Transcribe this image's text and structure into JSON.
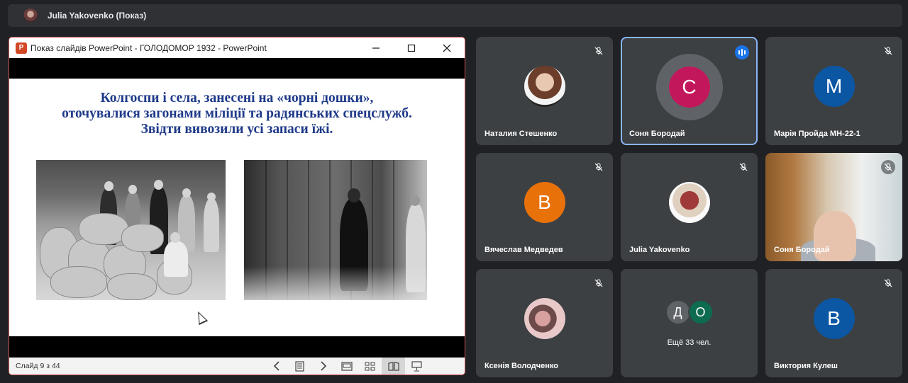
{
  "topbar": {
    "presenter_title": "Julia Yakovenko (Показ)"
  },
  "ppt": {
    "window_title": "Показ слайдів PowerPoint  -  ГОЛОДОМОР 1932  -  PowerPoint",
    "logo_letter": "P",
    "heading_line1": "Колгоспи і села, занесені на «чорні дошки»,",
    "heading_line2": "оточувалися загонами міліції та радянських спецслужб.",
    "heading_line3": "Звідти вивозили усі запаси їжі.",
    "slide_counter": "Слайд 9 з 44",
    "accent_color": "#d24726",
    "heading_color": "#1f3a8a"
  },
  "participants": [
    {
      "name": "Наталия Стешенко",
      "avatar": "photo",
      "muted": true
    },
    {
      "name": "Соня Бородай",
      "avatar_letter": "С",
      "avatar_color": "#c2185b",
      "speaking": true
    },
    {
      "name": "Марія Пройда МН-22-1",
      "avatar_letter": "М",
      "avatar_color": "#0b57a4",
      "muted": true
    },
    {
      "name": "Вячеслав Медведев",
      "avatar_letter": "В",
      "avatar_color": "#e8710a",
      "muted": true
    },
    {
      "name": "Julia Yakovenko",
      "avatar": "photo",
      "muted": true
    },
    {
      "name": "Соня Бородай",
      "avatar": "video",
      "muted": true
    },
    {
      "name": "Ксенія Володченко",
      "avatar": "photo",
      "muted": true
    },
    {
      "more_label": "Ещё 33 чел.",
      "more_letters": [
        "Д",
        "О"
      ],
      "more_colors": [
        "#5f6368",
        "#0d6b4f"
      ]
    },
    {
      "name": "Виктория Кулеш",
      "avatar_letter": "В",
      "avatar_color": "#0b57a4",
      "muted": true
    }
  ]
}
